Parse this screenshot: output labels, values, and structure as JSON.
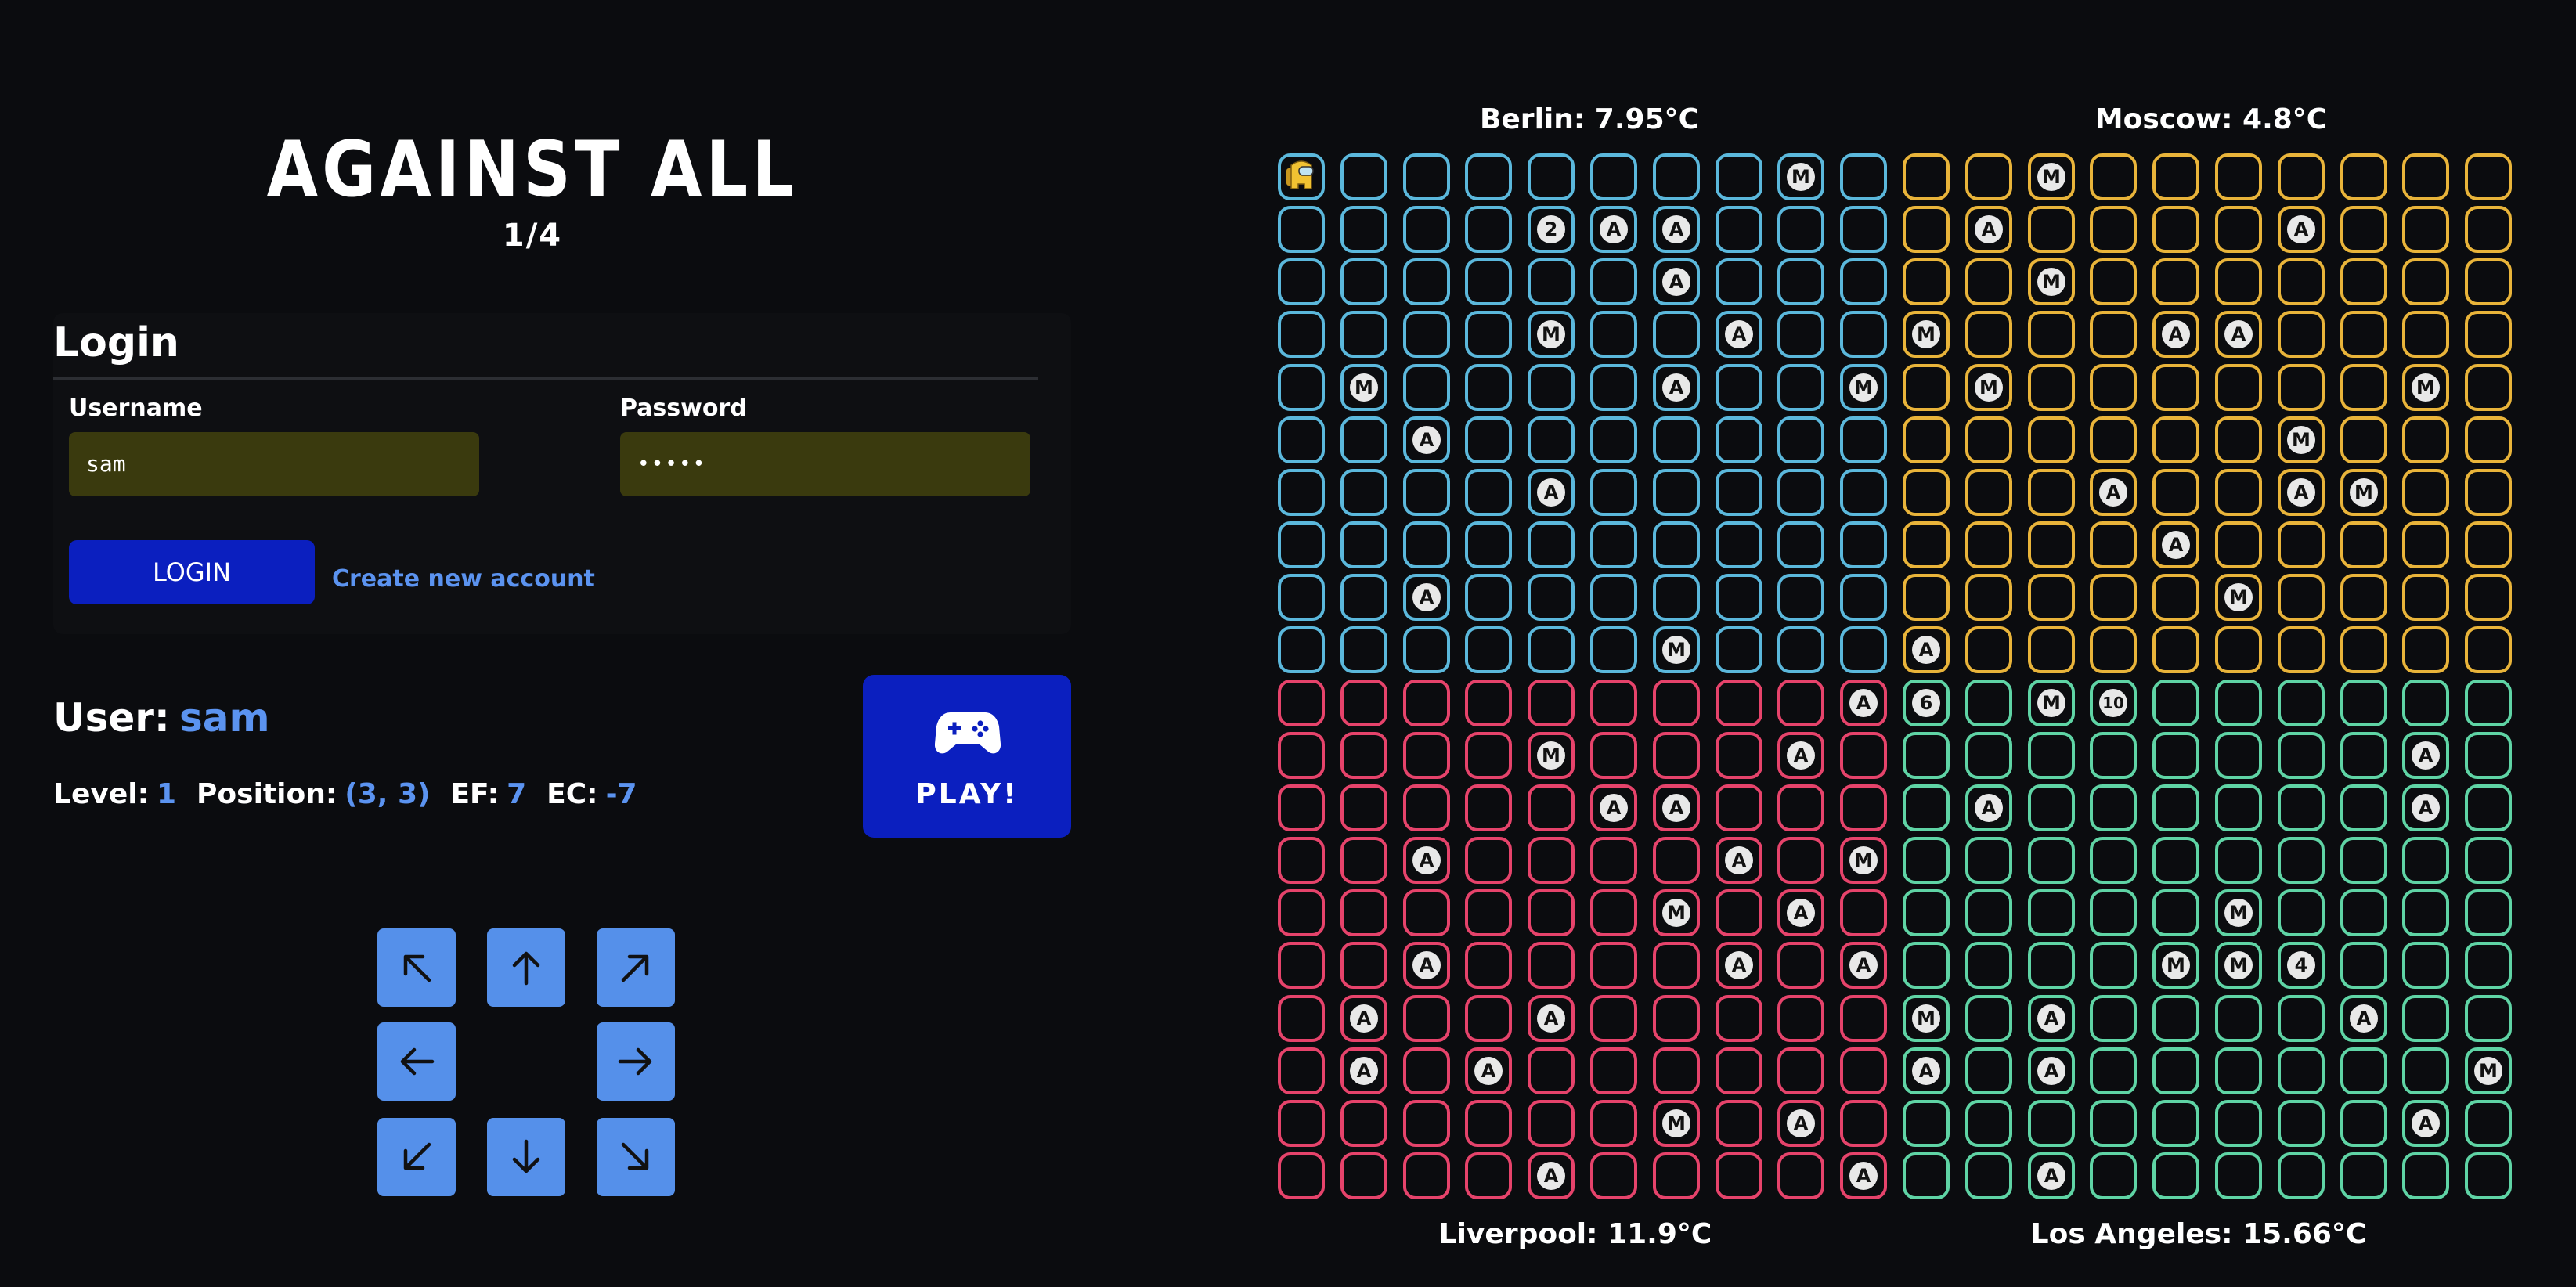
{
  "header": {
    "title": "AGAINST ALL",
    "subtitle": "1/4"
  },
  "login": {
    "heading": "Login",
    "username_label": "Username",
    "username_value": "sam",
    "password_label": "Password",
    "password_value": "•••••",
    "login_button": "LOGIN",
    "create_account_link": "Create new account"
  },
  "user": {
    "label": "User:",
    "name": "sam",
    "level_label": "Level:",
    "level": "1",
    "position_label": "Position:",
    "position": "(3, 3)",
    "ef_label": "EF:",
    "ef": "7",
    "ec_label": "EC:",
    "ec": "-7"
  },
  "play": {
    "label": "PLAY!",
    "icon": "gamepad-icon"
  },
  "controls": {
    "arrows": [
      "arrow-up-left-icon",
      "arrow-up-icon",
      "arrow-up-right-icon",
      "arrow-left-icon",
      "arrow-right-icon",
      "arrow-down-left-icon",
      "arrow-down-icon",
      "arrow-down-right-icon"
    ]
  },
  "colors": {
    "accent": "#5b93f0",
    "button_blue": "#0b1fbf",
    "input_bg": "#3a3a0e",
    "quadrant_top_left": "#5bb8dc",
    "quadrant_top_right": "#e9b43a",
    "quadrant_bottom_left": "#e6436b",
    "quadrant_bottom_right": "#5fd4a5"
  },
  "board": {
    "rows": 20,
    "cols": 20,
    "cities": {
      "top_left": "Berlin: 7.95°C",
      "top_right": "Moscow: 4.8°C",
      "bottom_left": "Liverpool: 11.9°C",
      "bottom_right": "Los Angeles: 15.66°C"
    },
    "player": {
      "row": 0,
      "col": 0,
      "icon": "player-avatar-icon"
    },
    "tokens": [
      [
        0,
        8,
        "M"
      ],
      [
        0,
        12,
        "M"
      ],
      [
        1,
        4,
        "2"
      ],
      [
        1,
        5,
        "A"
      ],
      [
        1,
        6,
        "A"
      ],
      [
        1,
        11,
        "A"
      ],
      [
        1,
        16,
        "A"
      ],
      [
        2,
        6,
        "A"
      ],
      [
        2,
        12,
        "M"
      ],
      [
        3,
        4,
        "M"
      ],
      [
        3,
        7,
        "A"
      ],
      [
        3,
        10,
        "M"
      ],
      [
        3,
        14,
        "A"
      ],
      [
        3,
        15,
        "A"
      ],
      [
        4,
        1,
        "M"
      ],
      [
        4,
        6,
        "A"
      ],
      [
        4,
        9,
        "M"
      ],
      [
        4,
        11,
        "M"
      ],
      [
        4,
        18,
        "M"
      ],
      [
        5,
        2,
        "A"
      ],
      [
        5,
        16,
        "M"
      ],
      [
        6,
        4,
        "A"
      ],
      [
        6,
        13,
        "A"
      ],
      [
        6,
        16,
        "A"
      ],
      [
        6,
        17,
        "M"
      ],
      [
        7,
        14,
        "A"
      ],
      [
        8,
        2,
        "A"
      ],
      [
        8,
        15,
        "M"
      ],
      [
        9,
        6,
        "M"
      ],
      [
        9,
        10,
        "A"
      ],
      [
        10,
        9,
        "A"
      ],
      [
        10,
        10,
        "6"
      ],
      [
        10,
        12,
        "M"
      ],
      [
        10,
        13,
        "10"
      ],
      [
        11,
        4,
        "M"
      ],
      [
        11,
        8,
        "A"
      ],
      [
        11,
        18,
        "A"
      ],
      [
        12,
        5,
        "A"
      ],
      [
        12,
        6,
        "A"
      ],
      [
        12,
        11,
        "A"
      ],
      [
        12,
        18,
        "A"
      ],
      [
        13,
        2,
        "A"
      ],
      [
        13,
        7,
        "A"
      ],
      [
        13,
        9,
        "M"
      ],
      [
        14,
        6,
        "M"
      ],
      [
        14,
        8,
        "A"
      ],
      [
        14,
        15,
        "M"
      ],
      [
        15,
        2,
        "A"
      ],
      [
        15,
        7,
        "A"
      ],
      [
        15,
        9,
        "A"
      ],
      [
        15,
        14,
        "M"
      ],
      [
        15,
        15,
        "M"
      ],
      [
        15,
        16,
        "4"
      ],
      [
        16,
        1,
        "A"
      ],
      [
        16,
        4,
        "A"
      ],
      [
        16,
        10,
        "M"
      ],
      [
        16,
        12,
        "A"
      ],
      [
        16,
        17,
        "A"
      ],
      [
        17,
        1,
        "A"
      ],
      [
        17,
        3,
        "A"
      ],
      [
        17,
        10,
        "A"
      ],
      [
        17,
        12,
        "A"
      ],
      [
        17,
        19,
        "M"
      ],
      [
        18,
        6,
        "M"
      ],
      [
        18,
        8,
        "A"
      ],
      [
        18,
        18,
        "A"
      ],
      [
        19,
        4,
        "A"
      ],
      [
        19,
        9,
        "A"
      ],
      [
        19,
        12,
        "A"
      ]
    ]
  }
}
